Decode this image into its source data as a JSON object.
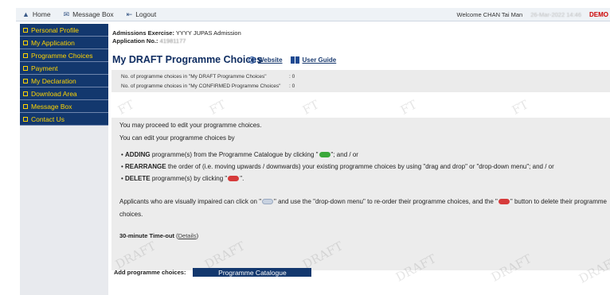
{
  "topbar": {
    "home_label": "Home",
    "message_box_label": "Message Box",
    "logout_label": "Logout",
    "welcome_text": "Welcome CHAN Tai Man",
    "date_text": "26-Mar-2022 14:46",
    "demo_label": "DEMO"
  },
  "sidebar": {
    "items": [
      {
        "label": "Personal Profile"
      },
      {
        "label": "My Application"
      },
      {
        "label": "Programme Choices"
      },
      {
        "label": "Payment"
      },
      {
        "label": "My Declaration"
      },
      {
        "label": "Download Area"
      },
      {
        "label": "Message Box"
      },
      {
        "label": "Contact Us"
      }
    ]
  },
  "header": {
    "exercise_label": "Admissions Exercise:",
    "exercise_value": "YYYY JUPAS Admission",
    "app_no_label": "Application No.:",
    "app_no_value": "41981177",
    "page_title": "My DRAFT Programme Choices",
    "website_link": "Website",
    "guide_link": "User Guide"
  },
  "counts": {
    "draft_label": "No. of programme choices in \"My DRAFT Programme Choices\"",
    "draft_value": ": 0",
    "confirmed_label": "No. of programme choices in \"My CONFIRMED Programme Choices\"",
    "confirmed_value": ": 0"
  },
  "notice": {
    "line1": "You may proceed to edit your programme choices.",
    "line2": "You can edit your programme choices by",
    "b1_strong": "ADDING",
    "b1_text_a": " programme(s) from the Programme Catalogue by clicking \"",
    "b1_text_b": "\"; and / or",
    "b2_strong": "REARRANGE",
    "b2_text": " the order of (i.e. moving upwards / downwards) your existing programme choices by using \"drag and drop\" or \"drop-down menu\"; and / or",
    "b3_strong": "DELETE",
    "b3_text_a": " programme(s) by clicking \"",
    "b3_text_b": "\".",
    "vi_text_a": "Applicants who are visually impaired can click on \"",
    "vi_text_b": "\" and use the \"drop-down menu\" to re-order their programme choices, and the \"",
    "vi_text_c": "\" button to delete their programme",
    "vi_text_d": "choices.",
    "timeout_label": "30-minute Time-out",
    "details_link": "Details"
  },
  "add": {
    "label": "Add programme choices:",
    "button": "Programme Catalogue"
  },
  "watermark": {
    "text_ft": "FT",
    "text_draft": "DRAFT"
  }
}
